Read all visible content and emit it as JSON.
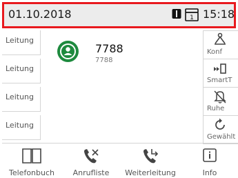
{
  "status_bar": {
    "date": "01.10.2018",
    "time": "15:18",
    "headset_icon": "headset-icon",
    "line_icon": "line-one-icon"
  },
  "line_keys": [
    {
      "label": "Leitung"
    },
    {
      "label": "Leitung"
    },
    {
      "label": "Leitung"
    },
    {
      "label": "Leitung"
    }
  ],
  "call": {
    "name": "7788",
    "number": "7788",
    "avatar_icon": "contact-avatar-icon",
    "avatar_color": "#1e8a3e"
  },
  "soft_keys": [
    {
      "label": "Konf",
      "icon": "conference-icon"
    },
    {
      "label": "SmartT",
      "icon": "smart-transfer-icon"
    },
    {
      "label": "Ruhe",
      "icon": "do-not-disturb-icon"
    },
    {
      "label": "Gewählt",
      "icon": "redial-icon"
    }
  ],
  "bottom_keys": [
    {
      "label": "Telefonbuch",
      "icon": "phonebook-icon"
    },
    {
      "label": "Anrufliste",
      "icon": "call-list-icon"
    },
    {
      "label": "Weiterleitung",
      "icon": "call-forward-icon"
    },
    {
      "label": "Info",
      "icon": "info-icon"
    }
  ],
  "colors": {
    "status_bar_border": "#e8191e",
    "status_bar_background": "#ececec",
    "accent_green": "#1e8a3e"
  }
}
